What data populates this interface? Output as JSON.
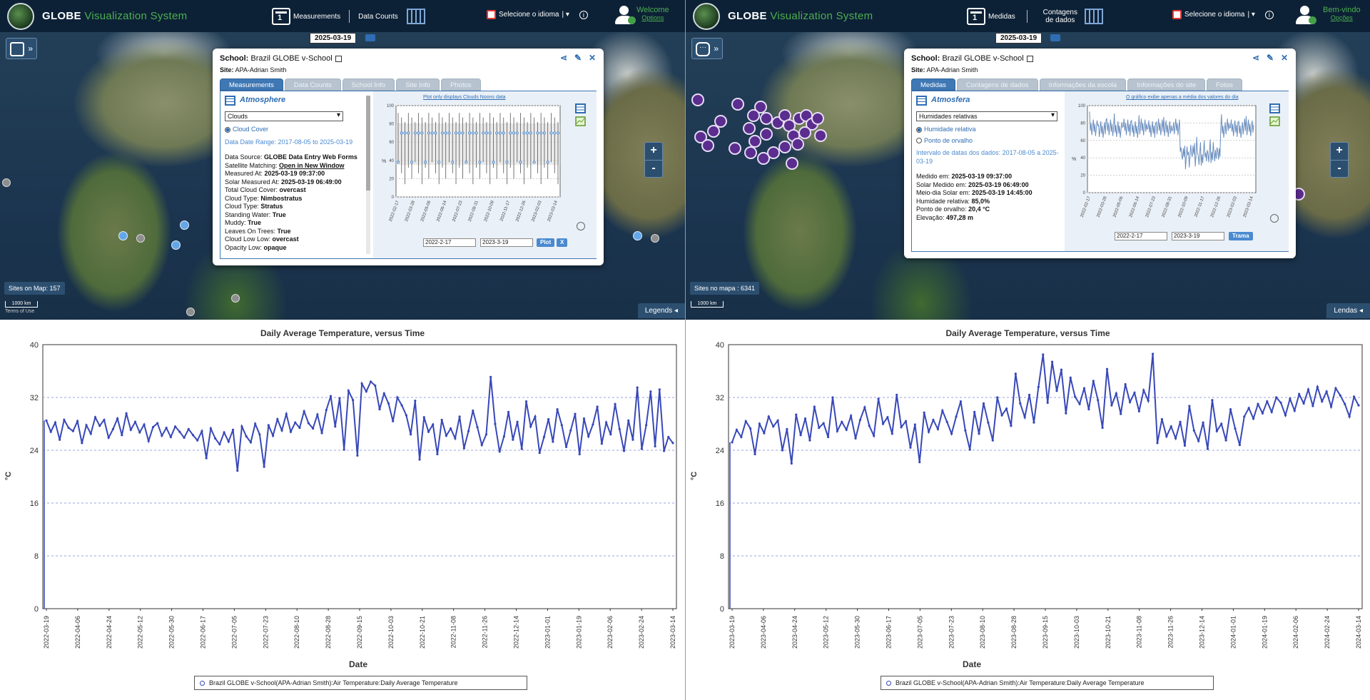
{
  "app": {
    "title_main": "GLOBE",
    "title_sub": "Visualization System"
  },
  "left": {
    "nav": {
      "measurements": "Measurements",
      "data_counts": "Data Counts",
      "language": "Selecione o idioma",
      "welcome": "Welcome",
      "options": "Options"
    },
    "map": {
      "date": "2025-03-19",
      "sites": "Sites on Map: 157",
      "scale": "1000 km",
      "attribution": "Terms of Use",
      "legends": "Legends",
      "zoom_in": "+",
      "zoom_out": "-"
    },
    "popup": {
      "school_label": "School:",
      "school": "Brazil GLOBE v-School",
      "site_label": "Site:",
      "site": "APA-Adrian Smith",
      "tabs": [
        "Measurements",
        "Data Counts",
        "School Info",
        "Site Info",
        "Photos"
      ],
      "section": "Atmosphere",
      "select": "Clouds",
      "radio": "Cloud Cover",
      "date_range": "Data Date Range: 2017-08-05 to 2025-03-19",
      "details": [
        {
          "k": "Data Source:",
          "v": "GLOBE Data Entry Web Forms"
        },
        {
          "k": "Satellite Matching:",
          "v": "Open in New Window",
          "link": true
        },
        {
          "k": "Measured At:",
          "v": "2025-03-19 09:37:00"
        },
        {
          "k": "Solar Measured At:",
          "v": "2025-03-19 06:49:00"
        },
        {
          "k": "Total Cloud Cover:",
          "v": "overcast"
        },
        {
          "k": "Cloud Type:",
          "v": "Nimbostratus"
        },
        {
          "k": "Cloud Type:",
          "v": "Stratus"
        },
        {
          "k": "Standing Water:",
          "v": "True"
        },
        {
          "k": "Muddy:",
          "v": "True"
        },
        {
          "k": "Leaves On Trees:",
          "v": "True"
        },
        {
          "k": "Cloud Low Low:",
          "v": "overcast"
        },
        {
          "k": "Opacity Low:",
          "v": "opaque"
        }
      ],
      "plot_note": "Plot only displays Clouds Noons data",
      "y_unit": "%",
      "y_ticks": [
        "100",
        "80",
        "60",
        "40",
        "20",
        "0"
      ],
      "x_ticks": [
        "2022-02-17",
        "2022-03-28",
        "2022-05-06",
        "2022-06-14",
        "2022-07-23",
        "2022-08-31",
        "2022-10-09",
        "2022-11-17",
        "2022-12-26",
        "2023-02-03",
        "2023-03-14"
      ],
      "from": "2022-2-17",
      "to": "2023-3-19",
      "plot_btn": "Plot",
      "close_btn": "X"
    },
    "chart_data": {
      "type": "line",
      "title": "Daily Average Temperature, versus Time",
      "xlabel": "Date",
      "ylabel": "°C",
      "ylim": [
        0,
        40
      ],
      "y_ticks": [
        "40",
        "32",
        "24",
        "16",
        "8",
        "0"
      ],
      "x_ticks": [
        "2022-03-19",
        "2022-04-06",
        "2022-04-24",
        "2022-05-12",
        "2022-05-30",
        "2022-06-17",
        "2022-07-05",
        "2022-07-23",
        "2022-08-10",
        "2022-08-28",
        "2022-09-15",
        "2022-10-03",
        "2022-10-21",
        "2022-11-08",
        "2022-11-26",
        "2022-12-14",
        "2023-01-01",
        "2023-01-19",
        "2023-02-06",
        "2023-02-24",
        "2023-03-14"
      ],
      "series": [
        {
          "name": "Brazil GLOBE v-School(APA-Adrian Smith):Air Temperature:Daily Average Temperature",
          "values": [
            28.5,
            26.8,
            28.2,
            25.6,
            28.6,
            27.4,
            26.9,
            28.4,
            25.1,
            27.8,
            26.5,
            29.0,
            27.7,
            28.6,
            25.9,
            27.2,
            28.8,
            26.3,
            29.6,
            27.1,
            28.3,
            26.7,
            27.9,
            25.4,
            27.5,
            28.1,
            26.2,
            27.4,
            26.0,
            27.6,
            26.8,
            25.9,
            27.2,
            26.3,
            25.5,
            26.9,
            22.8,
            27.3,
            25.8,
            24.9,
            26.7,
            25.3,
            27.1,
            20.9,
            27.6,
            26.1,
            25.2,
            28.0,
            26.4,
            21.5,
            27.8,
            26.2,
            28.7,
            27.0,
            29.5,
            26.8,
            28.2,
            27.4,
            29.9,
            28.1,
            27.3,
            29.4,
            26.6,
            30.1,
            32.2,
            27.6,
            31.9,
            24.1,
            33.0,
            31.6,
            23.2,
            34.1,
            32.9,
            34.4,
            33.8,
            30.2,
            32.6,
            31.1,
            28.4,
            32.0,
            30.8,
            29.3,
            26.4,
            31.5,
            22.6,
            29.0,
            26.8,
            27.9,
            23.4,
            28.6,
            26.2,
            27.3,
            25.8,
            29.1,
            24.3,
            26.9,
            30.0,
            27.5,
            24.8,
            26.4,
            35.1,
            28.0,
            23.8,
            26.1,
            29.8,
            25.6,
            28.3,
            24.2,
            31.4,
            27.6,
            29.1,
            23.6,
            26.0,
            28.7,
            25.3,
            30.2,
            27.8,
            24.5,
            27.0,
            29.5,
            23.4,
            28.8,
            26.1,
            27.9,
            30.6,
            25.0,
            28.2,
            26.4,
            31.0,
            27.2,
            23.9,
            28.5,
            25.6,
            33.5,
            24.2,
            27.8,
            32.9,
            24.6,
            33.2,
            23.9,
            26.0,
            25.1
          ]
        }
      ]
    }
  },
  "right": {
    "nav": {
      "measurements": "Medidas",
      "data_counts": "Contagens de dados",
      "language": "Selecione o idioma",
      "welcome": "Bem-vindo",
      "options": "Opções"
    },
    "map": {
      "date": "2025-03-19",
      "sites": "Sites no mapa : 6341",
      "scale": "1000 km",
      "attribution": "",
      "legends": "Lendas",
      "zoom_in": "+",
      "zoom_out": "-"
    },
    "popup": {
      "school_label": "School:",
      "school": "Brazil GLOBE v-School",
      "site_label": "Site:",
      "site": "APA-Adrian Smith",
      "tabs": [
        "Medidas",
        "Contagens de dados",
        "Informações da escola",
        "Informações do site",
        "Fotos"
      ],
      "section": "Atmosfera",
      "select": "Humidades relativas",
      "radio": "Humidade relativa",
      "radio2": "Ponto de orvalho",
      "date_range": "Intervalo de datas dos dados: 2017-08-05 a 2025-03-19",
      "details": [
        {
          "k": "Medido em:",
          "v": "2025-03-19 09:37:00"
        },
        {
          "k": "Solar Medido em:",
          "v": "2025-03-19 06:49:00"
        },
        {
          "k": "Meio-dia Solar em:",
          "v": "2025-03-19 14:45:00"
        },
        {
          "k": "Humidade relativa:",
          "v": "85,0%"
        },
        {
          "k": "Ponto de orvalho:",
          "v": "20,4 °C"
        },
        {
          "k": "Elevação:",
          "v": "497,28 m"
        }
      ],
      "plot_note": "O gráfico exibe apenas a média dos valores do dia",
      "y_unit": "%",
      "y_ticks": [
        "100",
        "80",
        "60",
        "40",
        "20",
        "0"
      ],
      "x_ticks": [
        "2022-02-17",
        "2022-03-28",
        "2022-05-06",
        "2022-06-14",
        "2022-07-23",
        "2022-08-31",
        "2022-10-09",
        "2022-11-17",
        "2022-12-26",
        "2023-02-03",
        "2023-03-14"
      ],
      "from": "2022-2-17",
      "to": "2023-3-19",
      "plot_btn": "Trama"
    },
    "chart_data": {
      "type": "line",
      "title": "Daily Average Temperature, versus Time",
      "xlabel": "Date",
      "ylabel": "°C",
      "ylim": [
        0,
        40
      ],
      "y_ticks": [
        "40",
        "32",
        "24",
        "16",
        "8",
        "0"
      ],
      "x_ticks": [
        "2023-03-19",
        "2023-04-06",
        "2023-04-24",
        "2023-05-12",
        "2023-05-30",
        "2023-06-17",
        "2023-07-05",
        "2023-07-23",
        "2023-08-10",
        "2023-08-28",
        "2023-09-15",
        "2023-10-03",
        "2023-10-21",
        "2023-11-08",
        "2023-11-26",
        "2023-12-14",
        "2024-01-01",
        "2024-01-19",
        "2024-02-06",
        "2024-02-24",
        "2024-03-14"
      ],
      "series": [
        {
          "name": "Brazil GLOBE v-School(APA-Adrian Smith):Air Temperature:Daily Average Temperature",
          "values": [
            25.2,
            27.1,
            26.0,
            28.4,
            27.3,
            23.4,
            28.0,
            26.6,
            29.1,
            27.6,
            28.5,
            24.0,
            27.2,
            22.0,
            29.4,
            26.3,
            28.8,
            25.5,
            30.6,
            27.4,
            28.1,
            26.0,
            32.0,
            26.9,
            28.3,
            27.1,
            29.2,
            25.8,
            28.6,
            30.5,
            27.7,
            26.2,
            31.8,
            28.0,
            29.0,
            26.5,
            32.4,
            27.5,
            28.4,
            24.4,
            27.9,
            22.2,
            29.7,
            26.8,
            28.6,
            27.2,
            30.0,
            28.3,
            26.5,
            29.1,
            31.4,
            27.0,
            24.1,
            29.8,
            26.5,
            31.1,
            28.2,
            25.5,
            32.0,
            29.3,
            30.3,
            27.7,
            35.6,
            31.1,
            29.0,
            32.4,
            28.2,
            33.6,
            38.5,
            31.2,
            37.4,
            33.0,
            36.2,
            29.6,
            35.0,
            32.1,
            31.0,
            33.4,
            30.2,
            34.5,
            31.6,
            27.4,
            36.3,
            30.8,
            32.6,
            29.5,
            34.0,
            31.3,
            32.7,
            29.9,
            33.1,
            31.5,
            38.6,
            25.1,
            28.7,
            26.1,
            27.6,
            25.8,
            28.3,
            24.7,
            30.7,
            27.0,
            25.4,
            28.2,
            24.2,
            31.6,
            26.9,
            28.0,
            25.5,
            30.2,
            27.3,
            24.8,
            29.1,
            30.4,
            28.8,
            31.0,
            29.6,
            31.4,
            29.8,
            32.0,
            31.2,
            29.3,
            31.8,
            30.0,
            32.5,
            31.1,
            33.2,
            30.7,
            33.6,
            31.4,
            32.9,
            30.6,
            33.4,
            32.3,
            31.0,
            29.1,
            32.1,
            30.8
          ]
        }
      ]
    }
  }
}
